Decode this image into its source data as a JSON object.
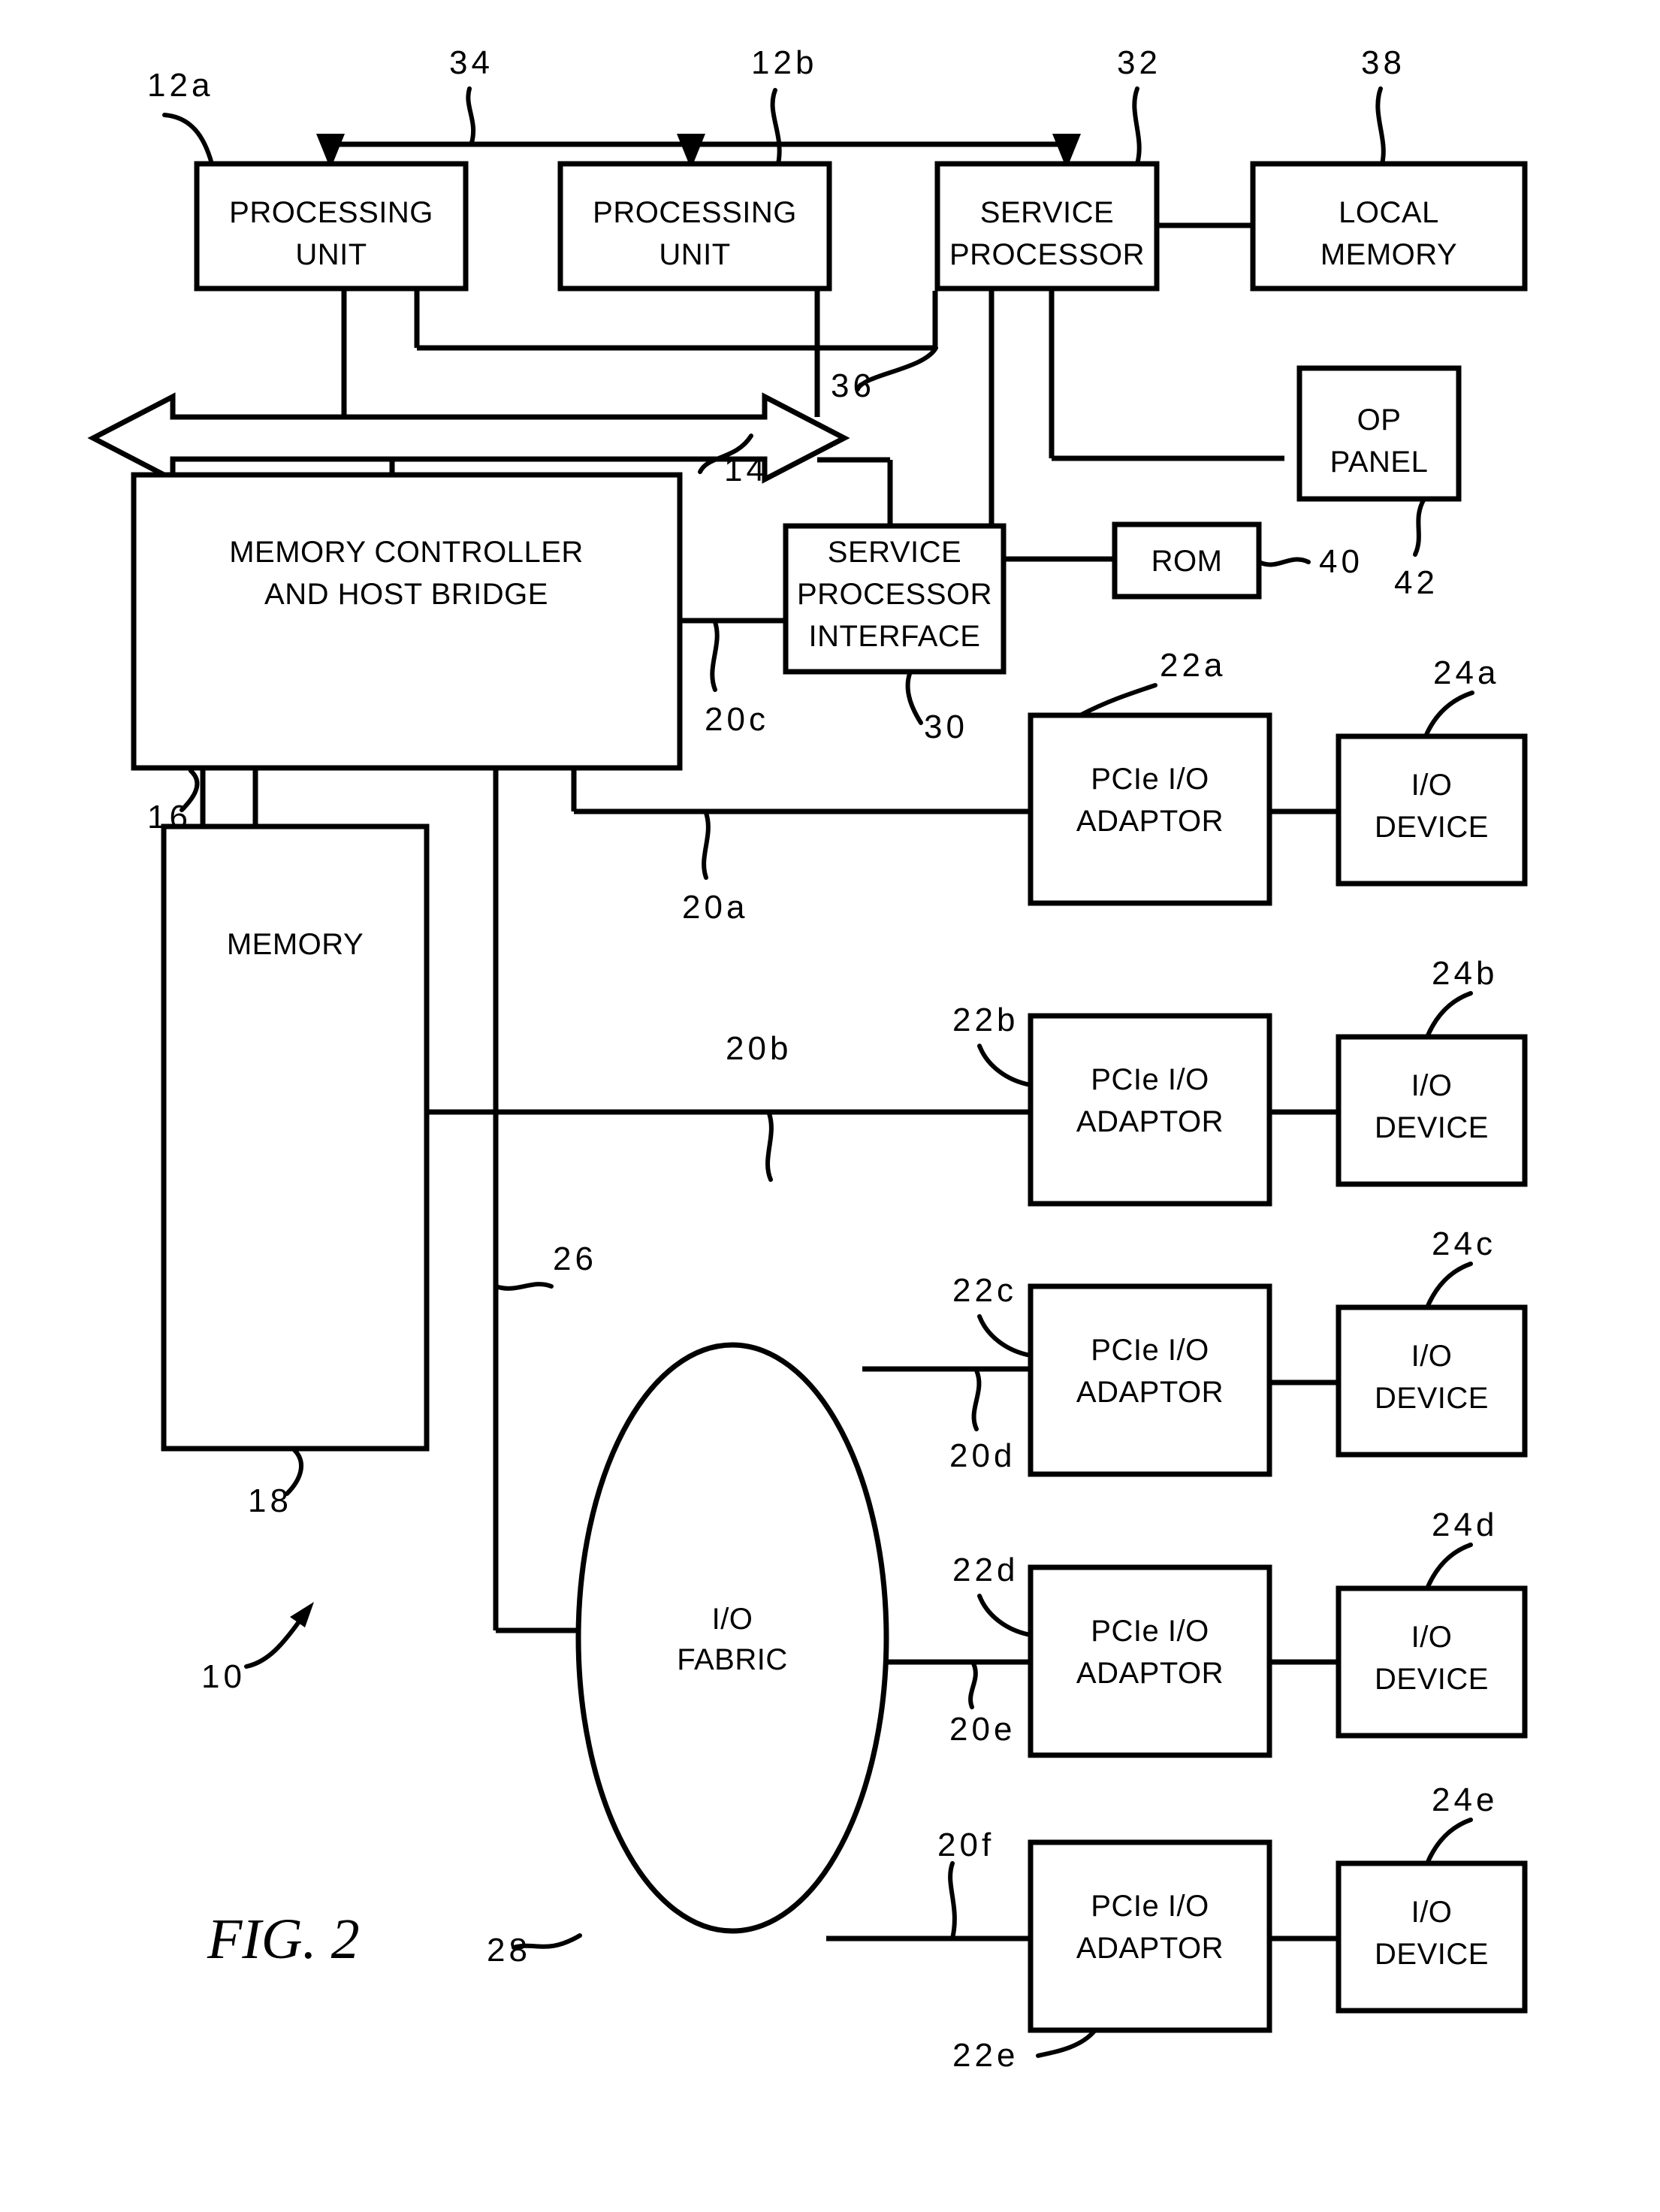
{
  "figure": {
    "caption": "FIG. 2",
    "system_ref": "10"
  },
  "blocks": [
    {
      "id": "processing-unit-a",
      "line1": "PROCESSING",
      "line2": "UNIT",
      "ref": "12a"
    },
    {
      "id": "processing-unit-b",
      "line1": "PROCESSING",
      "line2": "UNIT",
      "ref": "12b"
    },
    {
      "id": "service-processor",
      "line1": "SERVICE",
      "line2": "PROCESSOR",
      "ref": "32"
    },
    {
      "id": "local-memory",
      "line1": "LOCAL",
      "line2": "MEMORY",
      "ref": "38"
    },
    {
      "id": "op-panel",
      "line1": "OP",
      "line2": "PANEL",
      "ref": "42"
    },
    {
      "id": "rom",
      "line1": "ROM",
      "line2": "",
      "ref": "40"
    },
    {
      "id": "memory-controller-host-bridge",
      "line1": "MEMORY CONTROLLER",
      "line2": "AND HOST BRIDGE",
      "ref": "16"
    },
    {
      "id": "service-processor-interface",
      "line1": "SERVICE",
      "line2": "PROCESSOR",
      "line3": "INTERFACE",
      "ref": "30"
    },
    {
      "id": "memory",
      "line1": "MEMORY",
      "line2": "",
      "ref": "18"
    },
    {
      "id": "io-fabric",
      "line1": "I/O",
      "line2": "FABRIC",
      "ref": "28"
    }
  ],
  "adaptors": [
    {
      "id": "pcie-io-adaptor-a",
      "line1": "PCIe I/O",
      "line2": "ADAPTOR",
      "ref": "22a",
      "bus_ref": "20a",
      "device": {
        "id": "io-device-a",
        "line1": "I/O",
        "line2": "DEVICE",
        "ref": "24a"
      }
    },
    {
      "id": "pcie-io-adaptor-b",
      "line1": "PCIe I/O",
      "line2": "ADAPTOR",
      "ref": "22b",
      "bus_ref": "20b",
      "device": {
        "id": "io-device-b",
        "line1": "I/O",
        "line2": "DEVICE",
        "ref": "24b"
      }
    },
    {
      "id": "pcie-io-adaptor-c",
      "line1": "PCIe I/O",
      "line2": "ADAPTOR",
      "ref": "22c",
      "bus_ref": "20d",
      "device": {
        "id": "io-device-c",
        "line1": "I/O",
        "line2": "DEVICE",
        "ref": "24c"
      }
    },
    {
      "id": "pcie-io-adaptor-d",
      "line1": "PCIe I/O",
      "line2": "ADAPTOR",
      "ref": "22d",
      "bus_ref": "20e",
      "device": {
        "id": "io-device-d",
        "line1": "I/O",
        "line2": "DEVICE",
        "ref": "24d"
      }
    },
    {
      "id": "pcie-io-adaptor-e",
      "line1": "PCIe I/O",
      "line2": "ADAPTOR",
      "ref": "22e",
      "bus_ref": "20f",
      "device": {
        "id": "io-device-e",
        "line1": "I/O",
        "line2": "DEVICE",
        "ref": "24e"
      }
    }
  ],
  "bus_refs": {
    "interconnect_top": "34",
    "interconnect_service": "36",
    "system_bus": "14",
    "mem_ctrl_bus": "20c",
    "fabric_bus": "26"
  },
  "labels": {
    "ref_12a": "12a",
    "ref_12b": "12b",
    "ref_14": "14",
    "ref_16": "16",
    "ref_18": "18",
    "ref_20a": "20a",
    "ref_20b": "20b",
    "ref_20c": "20c",
    "ref_20d": "20d",
    "ref_20e": "20e",
    "ref_20f": "20f",
    "ref_22a": "22a",
    "ref_22b": "22b",
    "ref_22c": "22c",
    "ref_22d": "22d",
    "ref_22e": "22e",
    "ref_24a": "24a",
    "ref_24b": "24b",
    "ref_24c": "24c",
    "ref_24d": "24d",
    "ref_24e": "24e",
    "ref_26": "26",
    "ref_28": "28",
    "ref_30": "30",
    "ref_32": "32",
    "ref_34": "34",
    "ref_36": "36",
    "ref_38": "38",
    "ref_40": "40",
    "ref_42": "42",
    "ref_10": "10"
  },
  "text": {
    "processing_unit_l1": "PROCESSING",
    "processing_unit_l2": "UNIT",
    "service_processor_l1": "SERVICE",
    "service_processor_l2": "PROCESSOR",
    "local_memory_l1": "LOCAL",
    "local_memory_l2": "MEMORY",
    "op_panel_l1": "OP",
    "op_panel_l2": "PANEL",
    "rom": "ROM",
    "mem_ctrl_l1": "MEMORY CONTROLLER",
    "mem_ctrl_l2": "AND HOST BRIDGE",
    "spi_l1": "SERVICE",
    "spi_l2": "PROCESSOR",
    "spi_l3": "INTERFACE",
    "memory": "MEMORY",
    "fabric_l1": "I/O",
    "fabric_l2": "FABRIC",
    "adaptor_l1": "PCIe I/O",
    "adaptor_l2": "ADAPTOR",
    "device_l1": "I/O",
    "device_l2": "DEVICE",
    "fig_caption": "FIG. 2"
  },
  "colors": {
    "ink": "#000000",
    "paper": "#ffffff"
  }
}
